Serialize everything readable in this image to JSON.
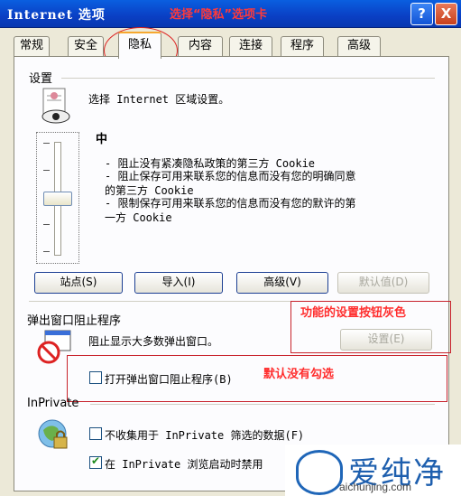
{
  "window": {
    "title": "Internet 选项",
    "help_symbol": "?",
    "close_symbol": "X"
  },
  "annotations": {
    "title_note": "选择“隐私”选项卡",
    "buttons_gray_note": "功能的设置按钮灰色",
    "default_unchecked_note": "默认没有勾选"
  },
  "tabs": [
    "常规",
    "安全",
    "隐私",
    "内容",
    "连接",
    "程序",
    "高级"
  ],
  "active_tab": "隐私",
  "settings": {
    "label": "设置",
    "zone_desc": "选择 Internet 区域设置。",
    "level": "中",
    "slider_level": 0.5,
    "desc_lines": [
      "- 阻止没有紧凑隐私政策的第三方 Cookie",
      "- 阻止保存可用来联系您的信息而没有您的明确同意",
      "的第三方 Cookie",
      "- 限制保存可用来联系您的信息而没有您的默许的第",
      "一方 Cookie"
    ],
    "buttons": {
      "sites": "站点(S)",
      "import": "导入(I)",
      "advanced": "高级(V)",
      "default": "默认值(D)"
    }
  },
  "popup_blocker": {
    "label": "弹出窗口阻止程序",
    "desc": "阻止显示大多数弹出窗口。",
    "settings_button": "设置(E)",
    "checkbox_label": "打开弹出窗口阻止程序(B)",
    "checked": false
  },
  "inprivate": {
    "label": "InPrivate",
    "option1_label": "不收集用于 InPrivate 筛选的数据(F)",
    "option1_checked": false,
    "option2_label": "在 InPrivate 浏览启动时禁用",
    "option2_checked": true
  },
  "watermark": {
    "brand": "爱纯净",
    "url": "aichunjing.com"
  },
  "colors": {
    "titlebar": "#0a46d0",
    "annotation": "#ff2e2e",
    "dialog_bg": "#ece9d8"
  }
}
